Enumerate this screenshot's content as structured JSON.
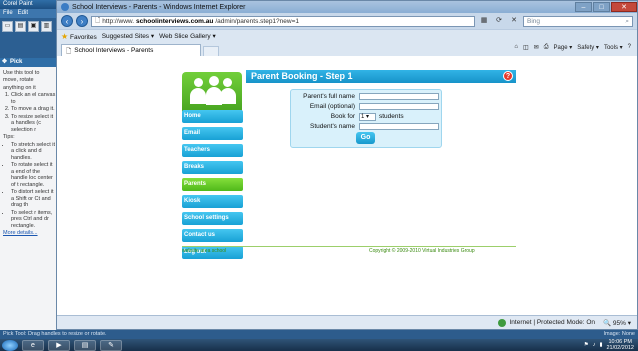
{
  "paint": {
    "title": "Corel Paint",
    "menu": [
      "File",
      "Edit"
    ],
    "toolbar": [
      "new",
      "open",
      "save",
      "paste"
    ],
    "panel_title": "Pick",
    "panel_lines": [
      "Use this tool to",
      "move, rotate",
      "anything on it"
    ],
    "panel_steps": [
      "Click an el canvas to",
      "To move a drag it.",
      "To resize select it a handles (c selection r"
    ],
    "tips_label": "Tips:",
    "tips": [
      "To stretch select it a click and d handles.",
      "To rotate select it a end of the handle loc center of t rectangle.",
      "To distort select it a Shift or Ct and drag th",
      "To select r items, pres Ctrl and dr rectangle."
    ],
    "more_details": "More details..."
  },
  "ie": {
    "title": "School Interviews - Parents - Windows Internet Explorer",
    "address_prefix": "http://www.",
    "address_domain": "schoolinterviews.com.au",
    "address_path": "/admin/parents.step1?new=1",
    "search_placeholder": "Bing",
    "favorites_label": "Favorites",
    "suggested_sites": "Suggested Sites",
    "web_slice": "Web Slice Gallery",
    "tab_title": "School Interviews - Parents",
    "cmd": [
      "Page",
      "Safety",
      "Tools"
    ],
    "status_zone": "Internet | Protected Mode: On",
    "zoom": "95%"
  },
  "page": {
    "header": "Parent Booking - Step 1",
    "help_icon": "?",
    "nav": [
      "Home",
      "Email",
      "Teachers",
      "Breaks",
      "Parents",
      "Kiosk",
      "School settings",
      "Contact us",
      "Log out"
    ],
    "active_nav": "Parents",
    "form": {
      "parent_name_label": "Parent's full name",
      "email_label": "Email (optional)",
      "book_for_label": "Book for",
      "book_for_value": "1",
      "students_label": "students",
      "student_name_label": "Student's name",
      "go_label": "Go"
    },
    "footer_left": "website area school",
    "footer_right": "Copyright © 2009-2010 Virtual Industries Group"
  },
  "paint_status": {
    "left": "Pick Tool: Drag handles to resize or rotate.",
    "right": "Image: None"
  },
  "taskbar": {
    "time": "10:06 PM",
    "date": "21/02/2012"
  }
}
